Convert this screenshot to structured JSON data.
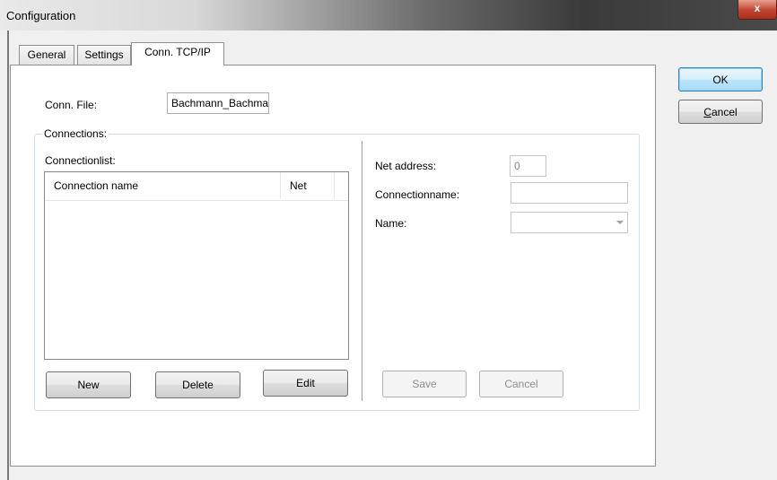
{
  "window": {
    "title": "Configuration",
    "close_label": "x"
  },
  "tabs": [
    {
      "label": "General",
      "active": false
    },
    {
      "label": "Settings",
      "active": false
    },
    {
      "label": "Conn. TCP/IP",
      "active": true
    }
  ],
  "dialog_buttons": {
    "ok_label": "OK",
    "cancel_first": "C",
    "cancel_rest": "ancel"
  },
  "conn_file": {
    "label": "Conn. File:",
    "value": "Bachmann_Bachma"
  },
  "connections_group": {
    "title": "Connections:",
    "list_label": "Connectionlist:",
    "columns": [
      "Connection name",
      "Net"
    ],
    "rows": [],
    "buttons": {
      "new": "New",
      "delete": "Delete",
      "edit": "Edit"
    }
  },
  "details": {
    "net_address_label": "Net address:",
    "net_address_value": "0",
    "connectionname_label": "Connectionname:",
    "connectionname_value": "",
    "name_label": "Name:",
    "name_value": "",
    "save_label": "Save",
    "cancel_label": "Cancel"
  },
  "icons": {
    "combo_arrow": "chevron-down-icon"
  }
}
